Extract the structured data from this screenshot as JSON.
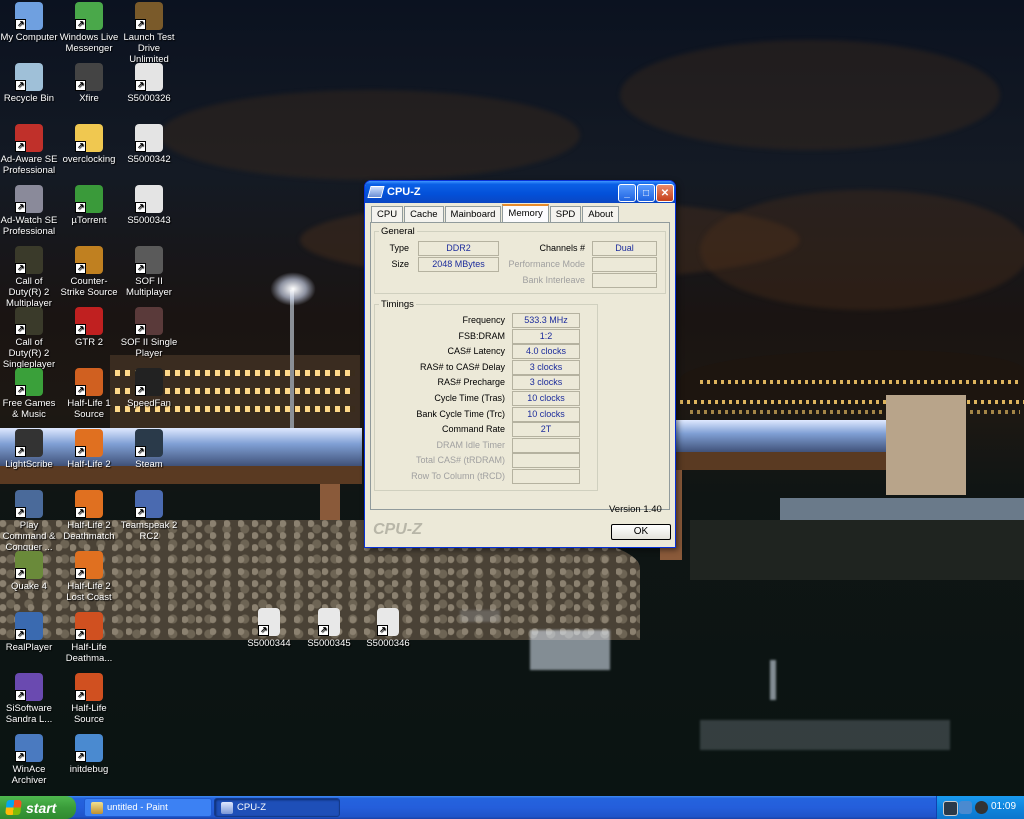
{
  "desktop_icons": [
    {
      "label": "My Computer",
      "icon": "computer-icon",
      "color": "#6fa0e0"
    },
    {
      "label": "Windows Live Messenger",
      "icon": "messenger-icon",
      "color": "#4aa84a"
    },
    {
      "label": "Launch Test Drive Unlimited",
      "icon": "test-drive-icon",
      "color": "#7a5a2a"
    },
    {
      "label": "Recycle Bin",
      "icon": "recycle-bin-icon",
      "color": "#9fc0d8"
    },
    {
      "label": "Xfire",
      "icon": "xfire-icon",
      "color": "#444444"
    },
    {
      "label": "S5000326",
      "icon": "image-file-icon",
      "color": "#e4e4e4"
    },
    {
      "label": "Ad-Aware SE Professional",
      "icon": "ad-aware-icon",
      "color": "#c0302a"
    },
    {
      "label": "overclocking",
      "icon": "folder-icon",
      "color": "#f0c850"
    },
    {
      "label": "S5000342",
      "icon": "image-file-icon",
      "color": "#e4e4e4"
    },
    {
      "label": "Ad-Watch SE Professional",
      "icon": "ad-watch-icon",
      "color": "#8a8a9a"
    },
    {
      "label": "µTorrent",
      "icon": "utorrent-icon",
      "color": "#3a9a3a"
    },
    {
      "label": "S5000343",
      "icon": "image-file-icon",
      "color": "#e4e4e4"
    },
    {
      "label": "Call of Duty(R) 2 Multiplayer",
      "icon": "cod2-icon",
      "color": "#3a3a2a"
    },
    {
      "label": "Counter-Strike Source",
      "icon": "counter-strike-icon",
      "color": "#c08020"
    },
    {
      "label": "SOF II Multiplayer",
      "icon": "sof2-icon",
      "color": "#5a5a5a"
    },
    {
      "label": "Call of Duty(R) 2 Singleplayer",
      "icon": "cod2-icon",
      "color": "#3a3a2a"
    },
    {
      "label": "GTR 2",
      "icon": "gtr2-icon",
      "color": "#c02020"
    },
    {
      "label": "SOF II Single Player",
      "icon": "sof2-icon",
      "color": "#5a3a3a"
    },
    {
      "label": "Free Games & Music",
      "icon": "free-games-icon",
      "color": "#3aa03a"
    },
    {
      "label": "Half-Life 1 Source",
      "icon": "half-life-icon",
      "color": "#d06020"
    },
    {
      "label": "SpeedFan",
      "icon": "speedfan-icon",
      "color": "#222222"
    },
    {
      "label": "LightScribe",
      "icon": "lightscribe-icon",
      "color": "#333333"
    },
    {
      "label": "Half-Life 2",
      "icon": "half-life-icon",
      "color": "#e07020"
    },
    {
      "label": "Steam",
      "icon": "steam-icon",
      "color": "#2a3a4a"
    },
    {
      "label": "Play Command & Conquer ...",
      "icon": "command-conquer-icon",
      "color": "#4a6a9a"
    },
    {
      "label": "Half-Life 2 Deathmatch",
      "icon": "half-life-icon",
      "color": "#e07020"
    },
    {
      "label": "Teamspeak 2 RC2",
      "icon": "teamspeak-icon",
      "color": "#4a6ab0"
    },
    {
      "label": "Quake 4",
      "icon": "quake-icon",
      "color": "#6a8a3a"
    },
    {
      "label": "Half-Life 2 Lost Coast",
      "icon": "half-life-icon",
      "color": "#e07020"
    },
    {
      "label": "",
      "icon": "",
      "color": ""
    },
    {
      "label": "RealPlayer",
      "icon": "realplayer-icon",
      "color": "#3a6ab0"
    },
    {
      "label": "Half-Life Deathma...",
      "icon": "half-life-icon",
      "color": "#d05020"
    },
    {
      "label": "",
      "icon": "",
      "color": ""
    },
    {
      "label": "SiSoftware Sandra L...",
      "icon": "sandra-icon",
      "color": "#6a4ab0"
    },
    {
      "label": "Half-Life Source",
      "icon": "half-life-icon",
      "color": "#d05020"
    },
    {
      "label": "",
      "icon": "",
      "color": ""
    },
    {
      "label": "WinAce Archiver",
      "icon": "winace-icon",
      "color": "#4a7ac0"
    },
    {
      "label": "initdebug",
      "icon": "info-file-icon",
      "color": "#4a8ad0"
    }
  ],
  "loose_icons": [
    {
      "label": "S5000344",
      "icon": "image-file-icon"
    },
    {
      "label": "S5000345",
      "icon": "image-file-icon"
    },
    {
      "label": "S5000346",
      "icon": "image-file-icon"
    }
  ],
  "cpuz": {
    "title": "CPU-Z",
    "tabs": [
      "CPU",
      "Cache",
      "Mainboard",
      "Memory",
      "SPD",
      "About"
    ],
    "active_tab": "Memory",
    "general": {
      "legend": "General",
      "type_label": "Type",
      "type_value": "DDR2",
      "size_label": "Size",
      "size_value": "2048 MBytes",
      "channels_label": "Channels #",
      "channels_value": "Dual",
      "perf_mode_label": "Performance Mode",
      "perf_mode_value": "",
      "bank_interleave_label": "Bank Interleave",
      "bank_interleave_value": ""
    },
    "timings": {
      "legend": "Timings",
      "rows": [
        {
          "label": "Frequency",
          "value": "533.3 MHz",
          "enabled": true
        },
        {
          "label": "FSB:DRAM",
          "value": "1:2",
          "enabled": true
        },
        {
          "label": "CAS# Latency",
          "value": "4.0 clocks",
          "enabled": true
        },
        {
          "label": "RAS# to CAS# Delay",
          "value": "3 clocks",
          "enabled": true
        },
        {
          "label": "RAS# Precharge",
          "value": "3 clocks",
          "enabled": true
        },
        {
          "label": "Cycle Time (Tras)",
          "value": "10 clocks",
          "enabled": true
        },
        {
          "label": "Bank Cycle Time (Trc)",
          "value": "10 clocks",
          "enabled": true
        },
        {
          "label": "Command Rate",
          "value": "2T",
          "enabled": true
        },
        {
          "label": "DRAM Idle Timer",
          "value": "",
          "enabled": false
        },
        {
          "label": "Total CAS# (tRDRAM)",
          "value": "",
          "enabled": false
        },
        {
          "label": "Row To Column (tRCD)",
          "value": "",
          "enabled": false
        }
      ]
    },
    "version": "Version 1.40",
    "brand": "CPU-Z",
    "ok_label": "OK"
  },
  "taskbar": {
    "start_label": "start",
    "buttons": [
      {
        "label": "untitled - Paint",
        "icon": "paint-icon",
        "active": false
      },
      {
        "label": "CPU-Z",
        "icon": "cpuz-icon",
        "active": true
      }
    ],
    "clock": "01:09",
    "tray_icons": [
      "steam-tray-icon",
      "network-tray-icon",
      "speedfan-tray-icon"
    ]
  }
}
